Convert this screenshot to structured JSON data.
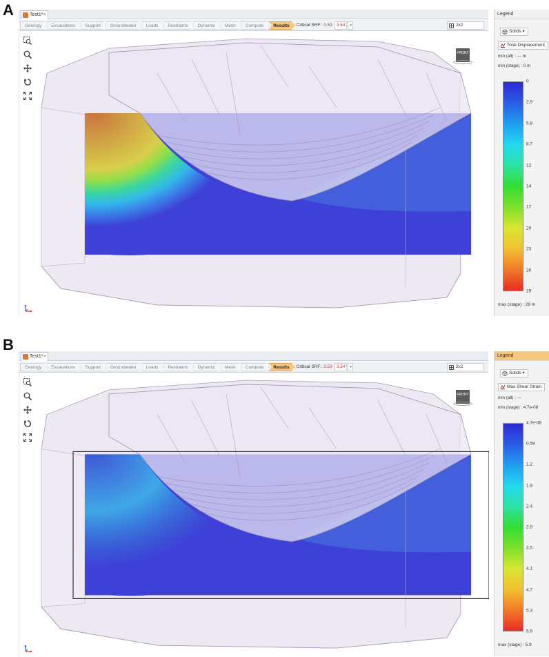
{
  "panels": [
    {
      "letter": "A",
      "doc_tab": "Test1*",
      "doc_close": "×",
      "stages": [
        "Geology",
        "Excavations",
        "Support",
        "Groundwater",
        "Loads",
        "Restraints",
        "Dynamic",
        "Mesh",
        "Compute",
        "Results"
      ],
      "active_stage": "Results",
      "critical_srf_label": "Critical SRF:",
      "critical_srf_value": "3.53",
      "critical_srf_input": "3.54",
      "layout_value": "2x2",
      "view_cube_label": "FRONT",
      "legend": {
        "title": "Legend",
        "highlighted": false,
        "solids_button": "Solids",
        "result_button": "Total Displacement",
        "min_all": "min (all) :    --- m",
        "min_stage": "min (stage) : 0 m",
        "max_stage": "max (stage) : 29 m",
        "ticks": [
          "0",
          "2.9",
          "5.8",
          "8.7",
          "12",
          "14",
          "17",
          "20",
          "23",
          "26",
          "29"
        ],
        "colors": [
          "#2c2bd6",
          "#2a5ce6",
          "#1e9ef0",
          "#22d9f0",
          "#2be3a3",
          "#33dd33",
          "#7ee02b",
          "#d9e632",
          "#f2c030",
          "#f07a28",
          "#ea2b22"
        ]
      },
      "contour": {
        "slip_fill": "#c9743e",
        "band_colors": [
          "#d8cf4a",
          "#8fe04a",
          "#3ad6a0",
          "#34b8ea",
          "#3a7be6"
        ],
        "base_color": "#3d41d8"
      }
    },
    {
      "letter": "B",
      "doc_tab": "Test1*",
      "doc_close": "×",
      "stages": [
        "Geology",
        "Excavations",
        "Support",
        "Groundwater",
        "Loads",
        "Restraints",
        "Dynamic",
        "Mesh",
        "Compute",
        "Results"
      ],
      "active_stage": "Results",
      "critical_srf_label": "Critical SRF:",
      "critical_srf_value": "3.53",
      "critical_srf_input": "3.54",
      "layout_value": "2x2",
      "view_cube_label": "FRONT",
      "legend": {
        "title": "Legend",
        "highlighted": true,
        "solids_button": "Solids",
        "result_button": "Max Shear Strain",
        "min_all": "min (all) :    ---",
        "min_stage": "min (stage) : 4.7e-08",
        "max_stage": "max (stage) : 5.9",
        "ticks": [
          "4.7e-08",
          "0.59",
          "1.2",
          "1.8",
          "2.4",
          "2.9",
          "3.5",
          "4.1",
          "4.7",
          "5.3",
          "5.9"
        ],
        "colors": [
          "#2c2bd6",
          "#2a5ce6",
          "#1e9ef0",
          "#22d9f0",
          "#2be3a3",
          "#33dd33",
          "#7ee02b",
          "#d9e632",
          "#f2c030",
          "#f07a28",
          "#ea2b22"
        ]
      },
      "contour": {
        "slip_fill": "#4058d8",
        "band_colors": [
          "#3fa8e6",
          "#3b8fe2",
          "#3a76dd",
          "#3a61d8",
          "#3b50d6"
        ],
        "base_color": "#3d41d8"
      }
    }
  ]
}
